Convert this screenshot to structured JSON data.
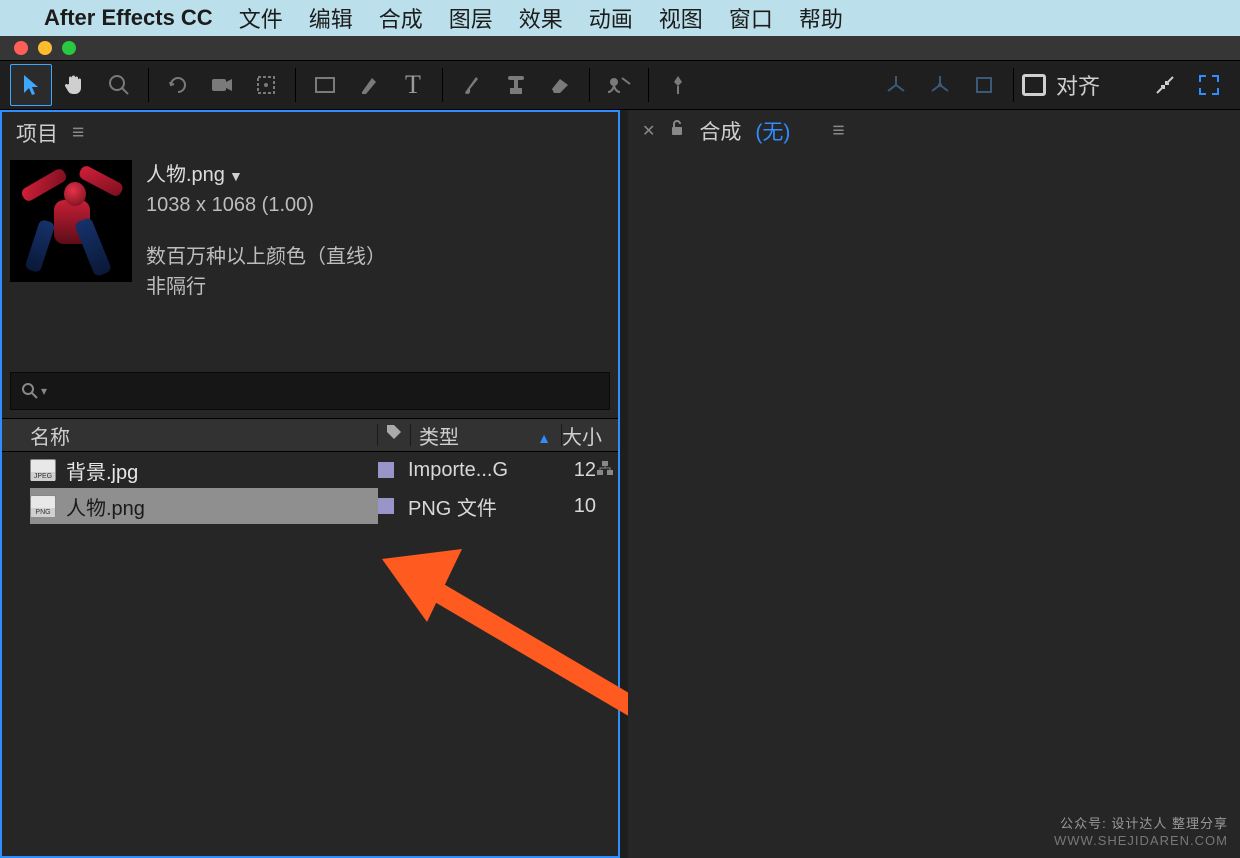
{
  "menubar": {
    "app_name": "After Effects CC",
    "items": [
      "文件",
      "编辑",
      "合成",
      "图层",
      "效果",
      "动画",
      "视图",
      "窗口",
      "帮助"
    ]
  },
  "toolbar": {
    "snapping_label": "对齐"
  },
  "project_panel": {
    "tab_label": "项目",
    "asset": {
      "filename": "人物.png",
      "dimensions": "1038 x 1068 (1.00)",
      "color_info": "数百万种以上颜色（直线）",
      "interlace": "非隔行"
    },
    "search_placeholder": "",
    "columns": {
      "name": "名称",
      "type": "类型",
      "size": "大小"
    },
    "rows": [
      {
        "ext": "JPEG",
        "name": "背景.jpg",
        "type": "Importe...G",
        "size": "12",
        "selected": false
      },
      {
        "ext": "PNG",
        "name": "人物.png",
        "type": "PNG 文件",
        "size": "10",
        "selected": true
      }
    ]
  },
  "comp_panel": {
    "tab_label": "合成",
    "none_label": "(无)"
  },
  "watermark": {
    "line1": "公众号: 设计达人 整理分享",
    "line2": "WWW.SHEJIDAREN.COM"
  }
}
